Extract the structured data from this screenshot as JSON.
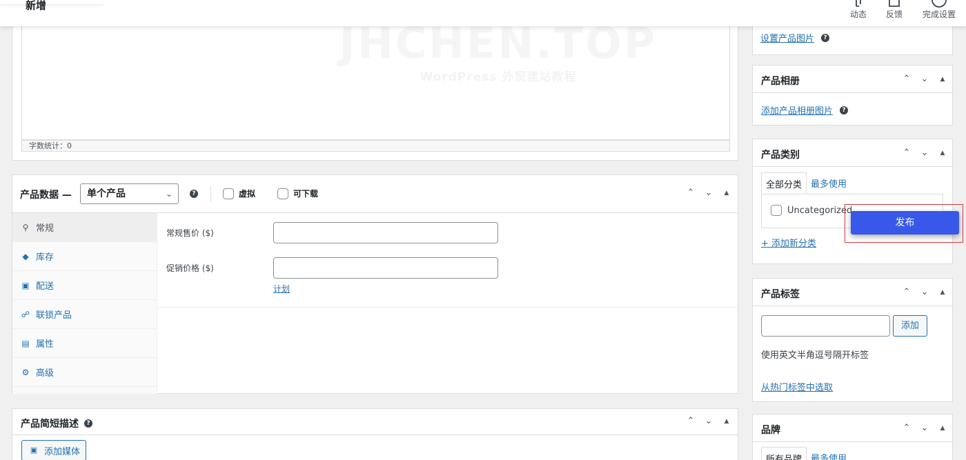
{
  "topbar": {
    "title": "新增",
    "actions": [
      {
        "label": "动态",
        "icon": "activity-icon"
      },
      {
        "label": "反馈",
        "icon": "feedback-icon"
      },
      {
        "label": "完成设置",
        "icon": "setup-progress-icon"
      }
    ]
  },
  "editor": {
    "watermark_main": "JHCHEN.TOP",
    "watermark_sub": "WordPress 外贸建站教程",
    "word_count": "字数统计：0"
  },
  "product_data": {
    "title": "产品数据 —",
    "type_selected": "单个产品",
    "virtual_label": "虚拟",
    "downloadable_label": "可下载",
    "tabs": [
      {
        "label": "常规",
        "icon": "wrench-icon"
      },
      {
        "label": "库存",
        "icon": "tag-icon"
      },
      {
        "label": "配送",
        "icon": "truck-icon"
      },
      {
        "label": "联锁产品",
        "icon": "link-icon"
      },
      {
        "label": "属性",
        "icon": "table-icon"
      },
      {
        "label": "高级",
        "icon": "gear-icon"
      }
    ],
    "regular_price_label": "常规售价 ($)",
    "sale_price_label": "促销价格 ($)",
    "schedule_link": "计划"
  },
  "short_description": {
    "title": "产品简短描述",
    "add_media": "添加媒体"
  },
  "sidebar": {
    "set_image_link": "设置产品图片",
    "gallery": {
      "title": "产品相册",
      "link": "添加产品相册图片"
    },
    "categories": {
      "title": "产品类别",
      "tab_all": "全部分类",
      "tab_most_used": "最多使用",
      "items": [
        "Uncategorized"
      ],
      "add_new": "+ 添加新分类"
    },
    "publish_button": "发布",
    "tags": {
      "title": "产品标签",
      "add_button": "添加",
      "hint": "使用英文半角逗号隔开标签",
      "popular_link": "从热门标签中选取"
    },
    "brands": {
      "title": "品牌",
      "tab_all": "所有品牌",
      "tab_most_used": "最多使用"
    }
  },
  "colors": {
    "accent": "#2271b1",
    "publish": "#3858e9",
    "highlight": "#d63638"
  }
}
